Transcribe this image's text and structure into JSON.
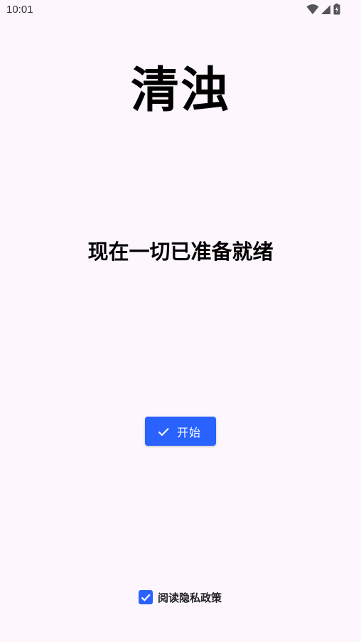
{
  "status_bar": {
    "time": "10:01",
    "icons": [
      "wifi-icon",
      "signal-icon",
      "battery-charging-icon"
    ]
  },
  "app": {
    "title": "清浊",
    "ready_message": "现在一切已准备就绪"
  },
  "start_button": {
    "label": "开始",
    "icon": "check-icon"
  },
  "privacy": {
    "label": "阅读隐私政策",
    "checked": true
  },
  "colors": {
    "background": "#fdf7fd",
    "accent": "#2962ff"
  }
}
